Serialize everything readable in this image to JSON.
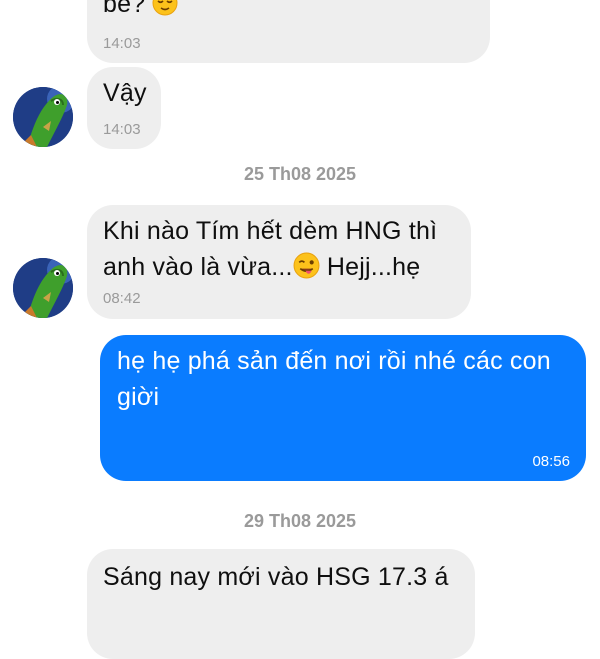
{
  "conversation": {
    "messages": [
      {
        "id": "m1",
        "direction": "incoming",
        "text": "bé?",
        "emoji": "relieved-face",
        "time": "14:03"
      },
      {
        "id": "m2",
        "direction": "incoming",
        "text": "Vậy",
        "time": "14:03"
      },
      {
        "id": "m3",
        "direction": "incoming",
        "line1": "Khi nào Tím hết dèm HNG thì",
        "line2_a": "anh vào là vừa...",
        "emoji": "winking-face-with-tongue",
        "line2_b": " Hejj...hẹ",
        "time": "08:42"
      },
      {
        "id": "m4",
        "direction": "outgoing",
        "line1": "hẹ hẹ phá sản đến nơi rồi nhé các con",
        "line2": "giời",
        "time": "08:56"
      },
      {
        "id": "m5",
        "direction": "incoming",
        "text": "Sáng nay mới vào HSG 17.3 á"
      }
    ],
    "date_separators": [
      "25 Th08 2025",
      "29 Th08 2025"
    ]
  },
  "colors": {
    "incoming_bubble": "#eeeeee",
    "outgoing_bubble": "#0a7cff",
    "timestamp": "#9a9a9a",
    "avatar_bg": "#1f3d86"
  }
}
